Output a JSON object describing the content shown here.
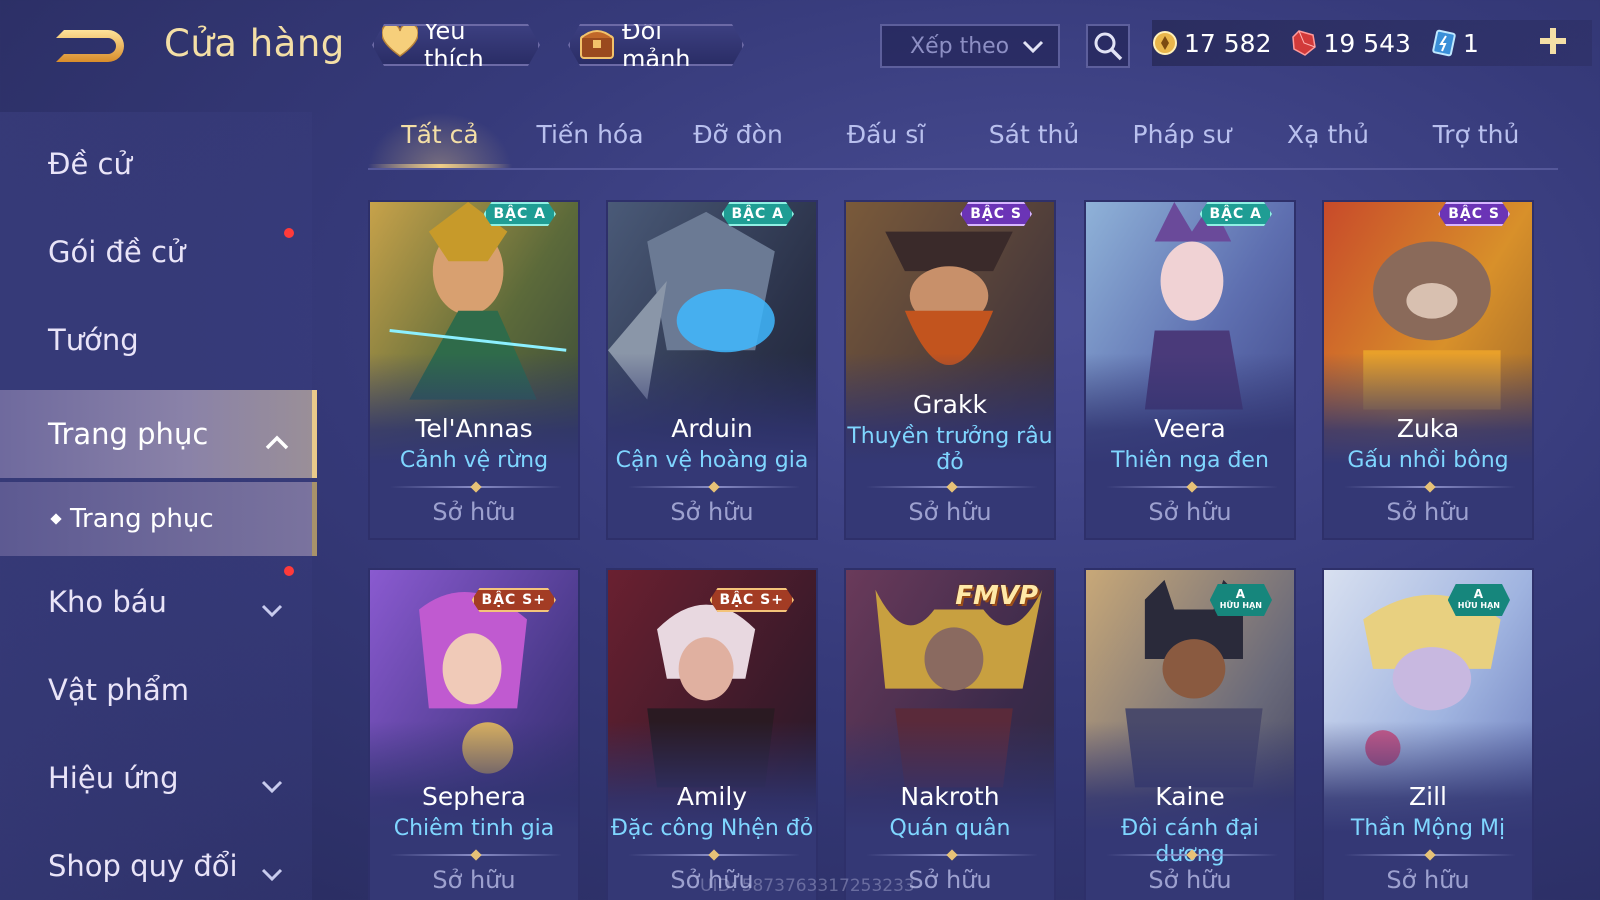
{
  "header": {
    "title": "Cửa hàng",
    "favorites_label": "Yêu thích",
    "exchange_label": "Đổi mảnh",
    "sort_placeholder": "Xếp theo",
    "currencies": [
      {
        "name": "gold",
        "value": "17 582"
      },
      {
        "name": "voucher",
        "value": "19 543"
      },
      {
        "name": "crystal",
        "value": "1"
      }
    ]
  },
  "sidebar": {
    "items": [
      {
        "label": "Đề cử"
      },
      {
        "label": "Gói đề cử"
      },
      {
        "label": "Tướng"
      },
      {
        "label": "Trang phục"
      },
      {
        "label": "Kho báu"
      },
      {
        "label": "Vật phẩm"
      },
      {
        "label": "Hiệu ứng"
      },
      {
        "label": "Shop quy đổi"
      }
    ],
    "sub_item": "Trang phục"
  },
  "tabs": [
    "Tất cả",
    "Tiến hóa",
    "Đỡ đòn",
    "Đấu sĩ",
    "Sát thủ",
    "Pháp sư",
    "Xạ thủ",
    "Trợ thủ"
  ],
  "cards": [
    {
      "hero": "Tel'Annas",
      "skin": "Cảnh vệ rừng",
      "badge": "BẬC A",
      "status": "Sở hữu"
    },
    {
      "hero": "Arduin",
      "skin": "Cận vệ hoàng gia",
      "badge": "BẬC A",
      "status": "Sở hữu"
    },
    {
      "hero": "Grakk",
      "skin": "Thuyền trưởng râu đỏ",
      "badge": "BẬC S",
      "status": "Sở hữu"
    },
    {
      "hero": "Veera",
      "skin": "Thiên nga đen",
      "badge": "BẬC A",
      "status": "Sở hữu"
    },
    {
      "hero": "Zuka",
      "skin": "Gấu nhồi bông",
      "badge": "BẬC S",
      "status": "Sở hữu"
    },
    {
      "hero": "Sephera",
      "skin": "Chiêm tinh gia",
      "badge": "BẬC S+",
      "status": "Sở hữu"
    },
    {
      "hero": "Amily",
      "skin": "Đặc công Nhện đỏ",
      "badge": "BẬC S+",
      "status": "Sở hữu"
    },
    {
      "hero": "Nakroth",
      "skin": "Quán quân",
      "badge": "FMVP",
      "status": "Sở hữu"
    },
    {
      "hero": "Kaine",
      "skin": "Đôi cánh đại dương",
      "badge": "A",
      "badge_sub": "HỮU HẠN",
      "status": "Sở hữu"
    },
    {
      "hero": "Zill",
      "skin": "Thần Mộng Mị",
      "badge": "A",
      "badge_sub": "HỮU HẠN",
      "status": "Sở hữu"
    }
  ],
  "uid": "UID: 5873763317253233",
  "colors": {
    "accent_gold": "#f4dfa6",
    "skin_name": "#7fd6ff",
    "notification": "#ff3a3a"
  }
}
